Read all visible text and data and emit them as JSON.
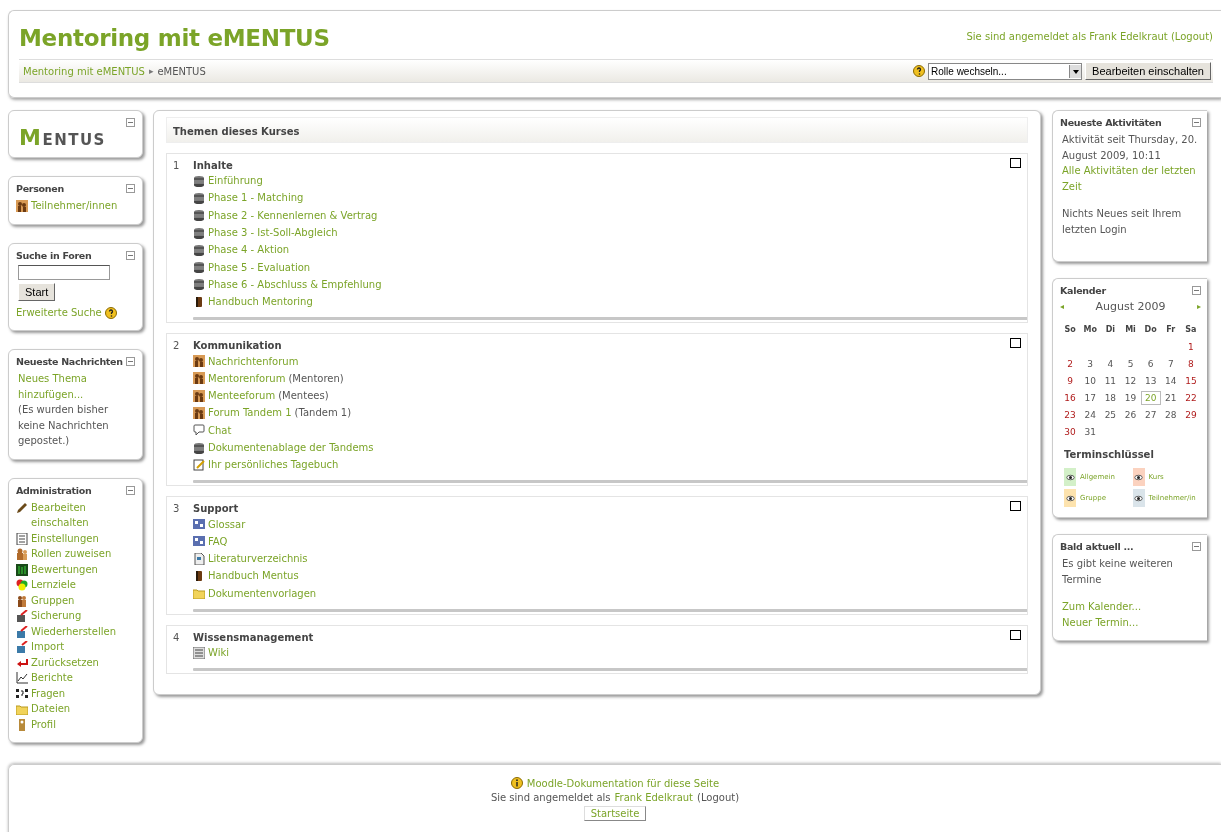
{
  "header": {
    "title": "Mentoring mit eMENTUS",
    "login": "Sie sind angemeldet als Frank Edelkraut (Logout)",
    "breadcrumb": {
      "separator": "▸",
      "items": [
        "Mentoring mit eMENTUS",
        "eMENTUS"
      ]
    },
    "role_select": "Rolle wechseln...",
    "edit_button": "Bearbeiten einschalten"
  },
  "left_blocks": [
    {
      "kind": "logo",
      "logo": "MENTUS"
    },
    {
      "kind": "links",
      "title": "Personen",
      "items": [
        {
          "kind": "people",
          "label": "Teilnehmer/innen"
        }
      ]
    },
    {
      "kind": "search",
      "title": "Suche in Foren",
      "button": "Start",
      "link": "Erweiterte Suche"
    },
    {
      "kind": "news",
      "title": "Neueste Nachrichten",
      "link": "Neues Thema hinzufügen...",
      "text": "(Es wurden bisher keine Nachrichten gepostet.)"
    },
    {
      "kind": "links",
      "title": "Administration",
      "items": [
        {
          "kind": "edit",
          "label": "Bearbeiten einschalten"
        },
        {
          "kind": "settings",
          "label": "Einstellungen"
        },
        {
          "kind": "roles",
          "label": "Rollen zuweisen"
        },
        {
          "kind": "grades",
          "label": "Bewertungen"
        },
        {
          "kind": "outcomes",
          "label": "Lernziele"
        },
        {
          "kind": "groups",
          "label": "Gruppen"
        },
        {
          "kind": "backup",
          "label": "Sicherung"
        },
        {
          "kind": "restore",
          "label": "Wiederherstellen"
        },
        {
          "kind": "import",
          "label": "Import"
        },
        {
          "kind": "reset",
          "label": "Zurücksetzen"
        },
        {
          "kind": "reports",
          "label": "Berichte"
        },
        {
          "kind": "questions",
          "label": "Fragen"
        },
        {
          "kind": "folder",
          "label": "Dateien"
        },
        {
          "kind": "profile",
          "label": "Profil"
        }
      ]
    }
  ],
  "course": {
    "title": "Themen dieses Kurses",
    "sections": [
      {
        "number": "1",
        "title": "Inhalte",
        "items": [
          {
            "kind": "resource",
            "label": "Einführung"
          },
          {
            "kind": "resource",
            "label": "Phase 1 - Matching"
          },
          {
            "kind": "resource",
            "label": "Phase 2 - Kennenlernen & Vertrag"
          },
          {
            "kind": "resource",
            "label": "Phase 3 - Ist-Soll-Abgleich"
          },
          {
            "kind": "resource",
            "label": "Phase 4 - Aktion"
          },
          {
            "kind": "resource",
            "label": "Phase 5 - Evaluation"
          },
          {
            "kind": "resource",
            "label": "Phase 6 - Abschluss & Empfehlung"
          },
          {
            "kind": "book",
            "label": "Handbuch Mentoring"
          }
        ]
      },
      {
        "number": "2",
        "title": "Kommunikation",
        "items": [
          {
            "kind": "forum",
            "label": "Nachrichtenforum"
          },
          {
            "kind": "forum",
            "label": "Mentorenforum",
            "group": "(Mentoren)"
          },
          {
            "kind": "forum",
            "label": "Menteeforum",
            "group": "(Mentees)"
          },
          {
            "kind": "forum",
            "label": "Forum Tandem 1",
            "group": "(Tandem 1)"
          },
          {
            "kind": "chat",
            "label": "Chat"
          },
          {
            "kind": "resource",
            "label": "Dokumentenablage der Tandems"
          },
          {
            "kind": "journal",
            "label": "Ihr persönliches Tagebuch"
          }
        ]
      },
      {
        "number": "3",
        "title": "Support",
        "items": [
          {
            "kind": "glossary",
            "label": "Glossar"
          },
          {
            "kind": "glossary",
            "label": "FAQ"
          },
          {
            "kind": "file",
            "label": "Literaturverzeichnis"
          },
          {
            "kind": "book",
            "label": "Handbuch Mentus"
          },
          {
            "kind": "folder",
            "label": "Dokumentenvorlagen"
          }
        ]
      },
      {
        "number": "4",
        "title": "Wissensmanagement",
        "items": [
          {
            "kind": "wiki",
            "label": "Wiki"
          }
        ]
      }
    ]
  },
  "recent": {
    "title": "Neueste Aktivitäten",
    "since": "Aktivität seit Thursday, 20. August 2009, 10:11",
    "link": "Alle Aktivitäten der letzten Zeit",
    "text": "Nichts Neues seit Ihrem letzten Login"
  },
  "calendar": {
    "title": "Kalender",
    "prev": "◂",
    "next": "▸",
    "month": "August 2009",
    "weekdays": [
      "So",
      "Mo",
      "Di",
      "Mi",
      "Do",
      "Fr",
      "Sa"
    ],
    "weeks": [
      [
        {
          "day": "1",
          "weekend": true,
          "today": false
        }
      ],
      [
        {
          "day": "2",
          "weekend": true,
          "today": false
        },
        {
          "day": "3",
          "weekend": false,
          "today": false
        },
        {
          "day": "4",
          "weekend": false,
          "today": false
        },
        {
          "day": "5",
          "weekend": false,
          "today": false
        },
        {
          "day": "6",
          "weekend": false,
          "today": false
        },
        {
          "day": "7",
          "weekend": false,
          "today": false
        },
        {
          "day": "8",
          "weekend": true,
          "today": false
        }
      ],
      [
        {
          "day": "9",
          "weekend": true,
          "today": false
        },
        {
          "day": "10",
          "weekend": false,
          "today": false
        },
        {
          "day": "11",
          "weekend": false,
          "today": false
        },
        {
          "day": "12",
          "weekend": false,
          "today": false
        },
        {
          "day": "13",
          "weekend": false,
          "today": false
        },
        {
          "day": "14",
          "weekend": false,
          "today": false
        },
        {
          "day": "15",
          "weekend": true,
          "today": false
        }
      ],
      [
        {
          "day": "16",
          "weekend": true,
          "today": false
        },
        {
          "day": "17",
          "weekend": false,
          "today": false
        },
        {
          "day": "18",
          "weekend": false,
          "today": false
        },
        {
          "day": "19",
          "weekend": false,
          "today": false
        },
        {
          "day": "20",
          "weekend": false,
          "today": true
        },
        {
          "day": "21",
          "weekend": false,
          "today": false
        },
        {
          "day": "22",
          "weekend": true,
          "today": false
        }
      ],
      [
        {
          "day": "23",
          "weekend": true,
          "today": false
        },
        {
          "day": "24",
          "weekend": false,
          "today": false
        },
        {
          "day": "25",
          "weekend": false,
          "today": false
        },
        {
          "day": "26",
          "weekend": false,
          "today": false
        },
        {
          "day": "27",
          "weekend": false,
          "today": false
        },
        {
          "day": "28",
          "weekend": false,
          "today": false
        },
        {
          "day": "29",
          "weekend": true,
          "today": false
        }
      ],
      [
        {
          "day": "30",
          "weekend": true,
          "today": false
        },
        {
          "day": "31",
          "weekend": false,
          "today": false
        }
      ]
    ],
    "legend_title": "Terminschlüssel",
    "legend": [
      {
        "label": "Allgemein",
        "color": "#d3f0c8"
      },
      {
        "label": "Kurs",
        "color": "#fbd2bf"
      },
      {
        "label": "Gruppe",
        "color": "#fde3ae"
      },
      {
        "label": "Teilnehmer/in",
        "color": "#dae4ea"
      }
    ]
  },
  "upcoming": {
    "title": "Bald aktuell ...",
    "text": "Es gibt keine weiteren Termine",
    "links": [
      "Zum Kalender...",
      "Neuer Termin..."
    ]
  },
  "footer": {
    "doc_link": "Moodle-Dokumentation für diese Seite",
    "login_prefix": "Sie sind angemeldet als",
    "user": "Frank Edelkraut",
    "logout": "(Logout)",
    "home_button": "Startseite"
  }
}
